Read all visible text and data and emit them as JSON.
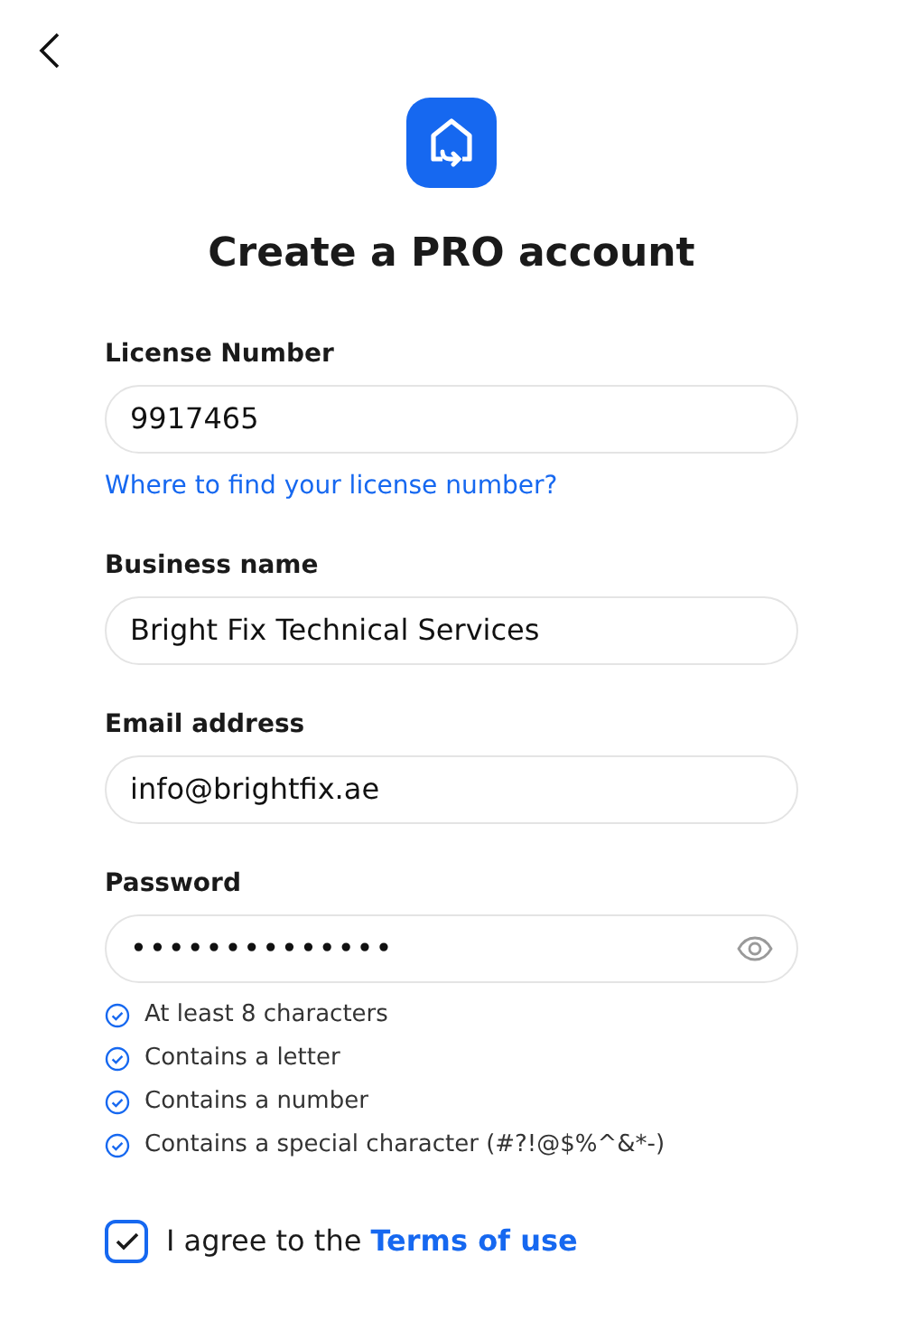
{
  "title": "Create a PRO account",
  "fields": [
    {
      "label": "License Number",
      "value": "9917465",
      "help_link": "Where to find your license number?"
    },
    {
      "label": "Business name",
      "value": "Bright Fix Technical Services"
    },
    {
      "label": "Email address",
      "value": "info@brightfix.ae"
    },
    {
      "label": "Password",
      "value": "••••••••••••••",
      "kind": "password"
    }
  ],
  "rules": [
    {
      "text": "At least 8 characters",
      "met": true
    },
    {
      "text": "Contains a letter",
      "met": true
    },
    {
      "text": "Contains a number",
      "met": true
    },
    {
      "text": "Contains a special character (#?!@$%^&*-)",
      "met": true
    }
  ],
  "agree": {
    "text": "I agree to the ",
    "link": "Terms of use",
    "checked": true
  }
}
